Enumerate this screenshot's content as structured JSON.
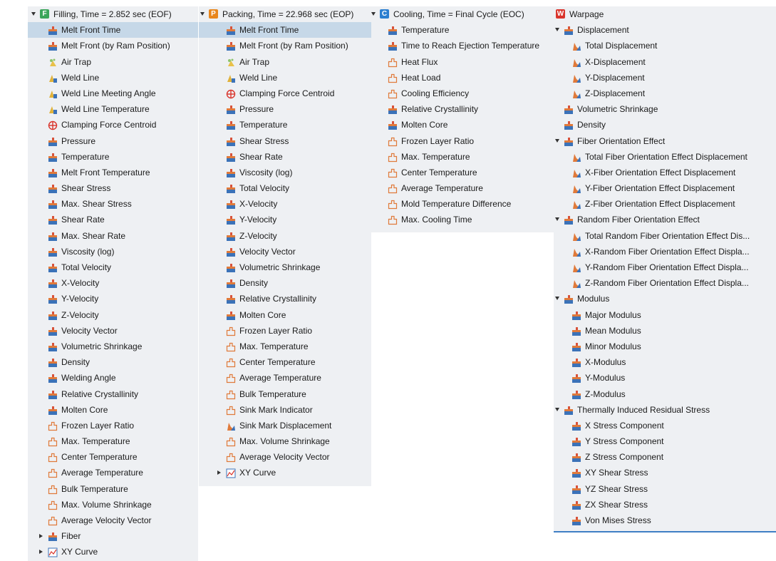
{
  "panels": [
    {
      "id": "filling",
      "title": "Filling, Time = 2.852 sec (EOF)",
      "header_letter": "F",
      "header_color": "#3aa55a",
      "items": [
        {
          "label": "Melt Front Time",
          "icon": "result-plot-icon",
          "selected": true
        },
        {
          "label": "Melt Front (by Ram Position)",
          "icon": "result-plot-icon"
        },
        {
          "label": "Air Trap",
          "icon": "air-trap-icon"
        },
        {
          "label": "Weld Line",
          "icon": "weld-line-icon"
        },
        {
          "label": "Weld Line Meeting Angle",
          "icon": "weld-line-icon"
        },
        {
          "label": "Weld Line Temperature",
          "icon": "weld-line-icon"
        },
        {
          "label": "Clamping Force Centroid",
          "icon": "crosshair-icon"
        },
        {
          "label": "Pressure",
          "icon": "result-plot-icon"
        },
        {
          "label": "Temperature",
          "icon": "result-plot-icon"
        },
        {
          "label": "Melt Front Temperature",
          "icon": "result-plot-icon"
        },
        {
          "label": "Shear Stress",
          "icon": "result-plot-icon"
        },
        {
          "label": "Max. Shear Stress",
          "icon": "result-plot-icon"
        },
        {
          "label": "Shear Rate",
          "icon": "result-plot-icon"
        },
        {
          "label": "Max. Shear Rate",
          "icon": "result-plot-icon"
        },
        {
          "label": "Viscosity (log)",
          "icon": "result-plot-icon"
        },
        {
          "label": "Total Velocity",
          "icon": "result-plot-icon"
        },
        {
          "label": "X-Velocity",
          "icon": "result-plot-icon"
        },
        {
          "label": "Y-Velocity",
          "icon": "result-plot-icon"
        },
        {
          "label": "Z-Velocity",
          "icon": "result-plot-icon"
        },
        {
          "label": "Velocity Vector",
          "icon": "result-plot-icon"
        },
        {
          "label": "Volumetric Shrinkage",
          "icon": "result-plot-icon"
        },
        {
          "label": "Density",
          "icon": "result-plot-icon"
        },
        {
          "label": "Welding Angle",
          "icon": "result-plot-icon"
        },
        {
          "label": "Relative Crystallinity",
          "icon": "result-plot-icon"
        },
        {
          "label": "Molten Core",
          "icon": "result-plot-icon"
        },
        {
          "label": "Frozen Layer Ratio",
          "icon": "outline-plot-icon"
        },
        {
          "label": "Max. Temperature",
          "icon": "outline-plot-icon"
        },
        {
          "label": "Center Temperature",
          "icon": "outline-plot-icon"
        },
        {
          "label": "Average Temperature",
          "icon": "outline-plot-icon"
        },
        {
          "label": "Bulk Temperature",
          "icon": "outline-plot-icon"
        },
        {
          "label": "Max. Volume Shrinkage",
          "icon": "outline-plot-icon"
        },
        {
          "label": "Average Velocity Vector",
          "icon": "outline-plot-icon"
        },
        {
          "label": "Fiber",
          "icon": "result-plot-icon",
          "collapsed": true
        },
        {
          "label": "XY Curve",
          "icon": "xy-curve-icon",
          "collapsed": true
        }
      ]
    },
    {
      "id": "packing",
      "title": "Packing, Time = 22.968 sec (EOP)",
      "header_letter": "P",
      "header_color": "#e8861c",
      "items": [
        {
          "label": "Melt Front Time",
          "icon": "result-plot-icon",
          "selected": true
        },
        {
          "label": "Melt Front (by Ram Position)",
          "icon": "result-plot-icon"
        },
        {
          "label": "Air Trap",
          "icon": "air-trap-icon"
        },
        {
          "label": "Weld Line",
          "icon": "weld-line-icon"
        },
        {
          "label": "Clamping Force Centroid",
          "icon": "crosshair-icon"
        },
        {
          "label": "Pressure",
          "icon": "result-plot-icon"
        },
        {
          "label": "Temperature",
          "icon": "result-plot-icon"
        },
        {
          "label": "Shear Stress",
          "icon": "result-plot-icon"
        },
        {
          "label": "Shear Rate",
          "icon": "result-plot-icon"
        },
        {
          "label": "Viscosity (log)",
          "icon": "result-plot-icon"
        },
        {
          "label": "Total Velocity",
          "icon": "result-plot-icon"
        },
        {
          "label": "X-Velocity",
          "icon": "result-plot-icon"
        },
        {
          "label": "Y-Velocity",
          "icon": "result-plot-icon"
        },
        {
          "label": "Z-Velocity",
          "icon": "result-plot-icon"
        },
        {
          "label": "Velocity Vector",
          "icon": "result-plot-icon"
        },
        {
          "label": "Volumetric Shrinkage",
          "icon": "result-plot-icon"
        },
        {
          "label": "Density",
          "icon": "result-plot-icon"
        },
        {
          "label": "Relative Crystallinity",
          "icon": "result-plot-icon"
        },
        {
          "label": "Molten Core",
          "icon": "result-plot-icon"
        },
        {
          "label": "Frozen Layer Ratio",
          "icon": "outline-plot-icon"
        },
        {
          "label": "Max. Temperature",
          "icon": "outline-plot-icon"
        },
        {
          "label": "Center Temperature",
          "icon": "outline-plot-icon"
        },
        {
          "label": "Average Temperature",
          "icon": "outline-plot-icon"
        },
        {
          "label": "Bulk Temperature",
          "icon": "outline-plot-icon"
        },
        {
          "label": "Sink Mark Indicator",
          "icon": "outline-plot-icon"
        },
        {
          "label": "Sink Mark Displacement",
          "icon": "deform-plot-icon"
        },
        {
          "label": "Max. Volume Shrinkage",
          "icon": "outline-plot-icon"
        },
        {
          "label": "Average Velocity Vector",
          "icon": "outline-plot-icon"
        },
        {
          "label": "XY Curve",
          "icon": "xy-curve-icon",
          "collapsed": true
        }
      ]
    },
    {
      "id": "cooling",
      "title": "Cooling, Time = Final Cycle (EOC)",
      "header_letter": "C",
      "header_color": "#2b7fd0",
      "items": [
        {
          "label": "Temperature",
          "icon": "result-plot-icon"
        },
        {
          "label": "Time to Reach Ejection Temperature",
          "icon": "result-plot-icon"
        },
        {
          "label": "Heat Flux",
          "icon": "outline-plot-icon"
        },
        {
          "label": "Heat Load",
          "icon": "outline-plot-icon"
        },
        {
          "label": "Cooling Efficiency",
          "icon": "outline-plot-icon"
        },
        {
          "label": "Relative Crystallinity",
          "icon": "result-plot-icon"
        },
        {
          "label": "Molten Core",
          "icon": "result-plot-icon"
        },
        {
          "label": "Frozen Layer Ratio",
          "icon": "outline-plot-icon"
        },
        {
          "label": "Max. Temperature",
          "icon": "outline-plot-icon"
        },
        {
          "label": "Center Temperature",
          "icon": "outline-plot-icon"
        },
        {
          "label": "Average Temperature",
          "icon": "outline-plot-icon"
        },
        {
          "label": "Mold Temperature Difference",
          "icon": "outline-plot-icon"
        },
        {
          "label": "Max. Cooling Time",
          "icon": "outline-plot-icon"
        }
      ]
    },
    {
      "id": "warpage",
      "title": "Warpage",
      "header_letter": "W",
      "header_color": "#d9342b",
      "items": [
        {
          "label": "Displacement",
          "icon": "result-plot-icon",
          "level": 1,
          "expanded": true
        },
        {
          "label": "Total Displacement",
          "icon": "deform-plot-icon",
          "level": 2
        },
        {
          "label": "X-Displacement",
          "icon": "deform-plot-icon",
          "level": 2
        },
        {
          "label": "Y-Displacement",
          "icon": "deform-plot-icon",
          "level": 2
        },
        {
          "label": "Z-Displacement",
          "icon": "deform-plot-icon",
          "level": 2
        },
        {
          "label": "Volumetric Shrinkage",
          "icon": "result-plot-icon",
          "level": 1
        },
        {
          "label": "Density",
          "icon": "result-plot-icon",
          "level": 1
        },
        {
          "label": "Fiber Orientation Effect",
          "icon": "result-plot-icon",
          "level": 1,
          "expanded": true
        },
        {
          "label": "Total Fiber Orientation Effect Displacement",
          "icon": "deform-plot-icon",
          "level": 2
        },
        {
          "label": "X-Fiber Orientation Effect Displacement",
          "icon": "deform-plot-icon",
          "level": 2
        },
        {
          "label": "Y-Fiber Orientation Effect Displacement",
          "icon": "deform-plot-icon",
          "level": 2
        },
        {
          "label": "Z-Fiber Orientation Effect Displacement",
          "icon": "deform-plot-icon",
          "level": 2
        },
        {
          "label": "Random Fiber Orientation Effect",
          "icon": "result-plot-icon",
          "level": 1,
          "expanded": true
        },
        {
          "label": "Total Random Fiber Orientation Effect Dis...",
          "icon": "deform-plot-icon",
          "level": 2
        },
        {
          "label": "X-Random Fiber Orientation Effect Displa...",
          "icon": "deform-plot-icon",
          "level": 2
        },
        {
          "label": "Y-Random Fiber Orientation Effect Displa...",
          "icon": "deform-plot-icon",
          "level": 2
        },
        {
          "label": "Z-Random Fiber Orientation Effect Displa...",
          "icon": "deform-plot-icon",
          "level": 2
        },
        {
          "label": "Modulus",
          "icon": "result-plot-icon",
          "level": 1,
          "expanded": true
        },
        {
          "label": "Major Modulus",
          "icon": "result-plot-icon",
          "level": 2
        },
        {
          "label": "Mean Modulus",
          "icon": "result-plot-icon",
          "level": 2
        },
        {
          "label": "Minor Modulus",
          "icon": "result-plot-icon",
          "level": 2
        },
        {
          "label": "X-Modulus",
          "icon": "result-plot-icon",
          "level": 2
        },
        {
          "label": "Y-Modulus",
          "icon": "result-plot-icon",
          "level": 2
        },
        {
          "label": "Z-Modulus",
          "icon": "result-plot-icon",
          "level": 2
        },
        {
          "label": "Thermally Induced Residual Stress",
          "icon": "result-plot-icon",
          "level": 1,
          "expanded": true
        },
        {
          "label": "X Stress Component",
          "icon": "result-plot-icon",
          "level": 2
        },
        {
          "label": "Y Stress Component",
          "icon": "result-plot-icon",
          "level": 2
        },
        {
          "label": "Z Stress Component",
          "icon": "result-plot-icon",
          "level": 2
        },
        {
          "label": "XY Shear Stress",
          "icon": "result-plot-icon",
          "level": 2
        },
        {
          "label": "YZ Shear Stress",
          "icon": "result-plot-icon",
          "level": 2
        },
        {
          "label": "ZX Shear Stress",
          "icon": "result-plot-icon",
          "level": 2
        },
        {
          "label": "Von Mises Stress",
          "icon": "result-plot-icon",
          "level": 2
        }
      ]
    }
  ]
}
